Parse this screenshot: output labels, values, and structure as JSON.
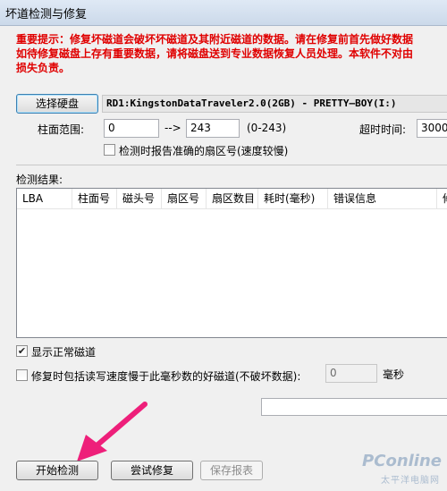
{
  "window": {
    "title": "坏道检测与修复"
  },
  "warning": {
    "line1": "重要提示：修复坏磁道会破坏坏磁道及其附近磁道的数据。请在修复前首先做好数据",
    "line2": "如待修复磁盘上存有重要数据，请将磁盘送到专业数据恢复人员处理。本软件不对由",
    "line3": "损失负责。"
  },
  "disk": {
    "select_button": "选择硬盘",
    "label": "RD1:KingstonDataTraveler2.0(2GB) - PRETTY—BOY(I:)"
  },
  "range": {
    "label": "柱面范围:",
    "from": "0",
    "arrow": "-->",
    "to": "243",
    "hint": "(0-243)"
  },
  "timeout": {
    "label": "超时时间:",
    "value": "3000"
  },
  "options": {
    "report_sector": "检测时报告准确的扇区号(速度较慢)",
    "show_normal": "显示正常磁道",
    "include_slow": "修复时包括读写速度慢于此毫秒数的好磁道(不破坏数据):",
    "slow_value": "0",
    "slow_unit": "毫秒"
  },
  "results": {
    "label": "检测结果:",
    "columns": [
      "LBA",
      "柱面号",
      "磁头号",
      "扇区号",
      "扇区数目",
      "耗时(毫秒)",
      "错误信息",
      "修"
    ]
  },
  "buttons": {
    "start": "开始检测",
    "repair": "尝试修复",
    "save": "保存报表"
  },
  "watermark": {
    "brand": "PConline",
    "sub": "太平洋电脑网"
  },
  "colors": {
    "warning": "#e00000",
    "arrow": "#ee1f7a"
  }
}
